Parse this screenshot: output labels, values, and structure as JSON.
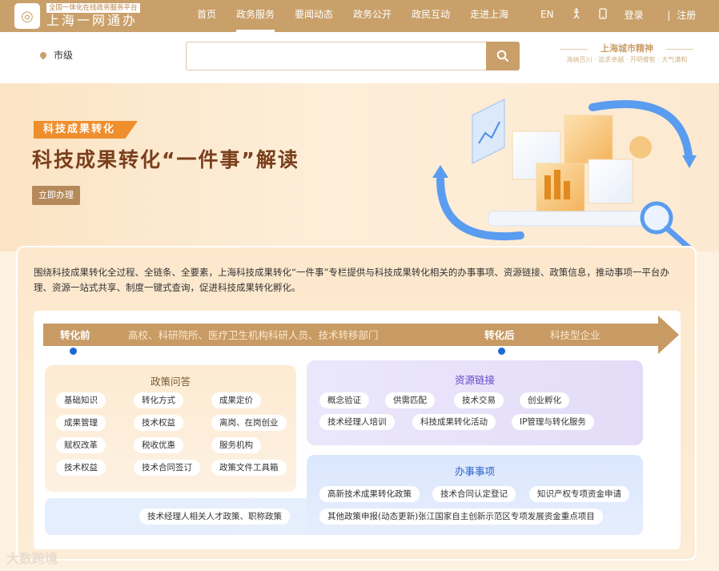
{
  "header": {
    "logo_subtitle": "全国一体化在线政务服务平台",
    "logo_title": "上海一网通办",
    "nav": [
      "首页",
      "政务服务",
      "要闻动态",
      "政务公开",
      "政民互动",
      "走进上海"
    ],
    "active_nav": "政务服务",
    "lang": "EN",
    "login": "登录",
    "separator": "|",
    "register": "注册"
  },
  "search": {
    "location": "市级",
    "placeholder": "",
    "spirit_title": "上海城市精神",
    "spirit_sub": "海纳百川 · 追求卓越 · 开明睿智 · 大气谦和"
  },
  "banner": {
    "tag": "科技成果转化",
    "headline": "科技成果转化“一件事”解读",
    "cta": "立即办理"
  },
  "intro": "围绕科技成果转化全过程、全链条、全要素，上海科技成果转化“一件事”专栏提供与科技成果转化相关的办事事项、资源链接、政策信息，推动事项一平台办理、资源一站式共享、制度一键式查询，促进科技成果转化孵化。",
  "flow": {
    "before_label": "转化前",
    "before_desc": "高校、科研院所、医疗卫生机构科研人员、技术转移部门",
    "after_label": "转化后",
    "after_desc": "科技型企业"
  },
  "policy": {
    "title": "政策问答",
    "items": [
      "基础知识",
      "转化方式",
      "成果定价",
      "成果管理",
      "技术权益",
      "离岗、在岗创业",
      "赋权改革",
      "税收优惠",
      "服务机构",
      "技术权益",
      "技术合同签订",
      "政策文件工具箱",
      "技术经理人相关人才政策、职称政策"
    ]
  },
  "resource": {
    "title": "资源链接",
    "items": [
      "概念验证",
      "供需匹配",
      "技术交易",
      "创业孵化",
      "技术经理人培训",
      "科技成果转化活动",
      "IP管理与转化服务"
    ]
  },
  "affairs": {
    "title": "办事事项",
    "items": [
      "高新技术成果转化政策",
      "技术合同认定登记",
      "知识产权专项资金申请",
      "其他政策申报(动态更新)张江国家自主创新示范区专项发展资金重点项目"
    ]
  },
  "watermark": "大数跨境",
  "colors": {
    "brand": "#c9a06a",
    "tag": "#ef8e2d",
    "headline": "#7a3f1d",
    "resource_title": "#6148c6",
    "affairs_title": "#2c64c9"
  }
}
